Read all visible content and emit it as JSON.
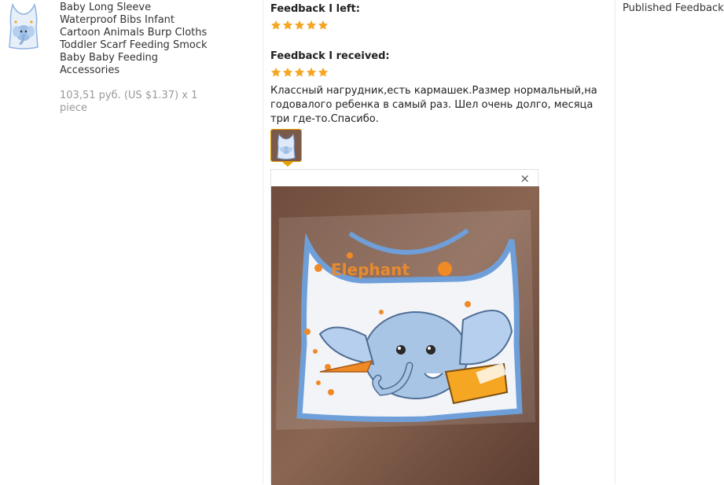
{
  "product": {
    "title": "Baby Long Sleeve Waterproof Bibs Infant Cartoon Animals Burp Cloths Toddler Scarf Feeding Smock Baby Baby Feeding Accessories",
    "price_line": "103,51 руб. (US $1.37) x 1 piece",
    "thumbnail_icon": "bib-product-thumbnail"
  },
  "feedback_left": {
    "heading": "Feedback I left:",
    "rating": 5,
    "max_rating": 5
  },
  "feedback_received": {
    "heading": "Feedback I received:",
    "rating": 5,
    "max_rating": 5,
    "text": "Классный нагрудник,есть кармашек.Размер нормальный,на годовалого ребенка в самый раз. Шел очень долго, месяца три где-то.Спасибо."
  },
  "photo_viewer": {
    "close_label": "×",
    "photo_text": "Elephant",
    "photo_count": 1
  },
  "status": {
    "published_label": "Published Feedback"
  },
  "colors": {
    "star": "#f5a623",
    "thumb_border": "#e8a200",
    "divider": "#ececec"
  }
}
